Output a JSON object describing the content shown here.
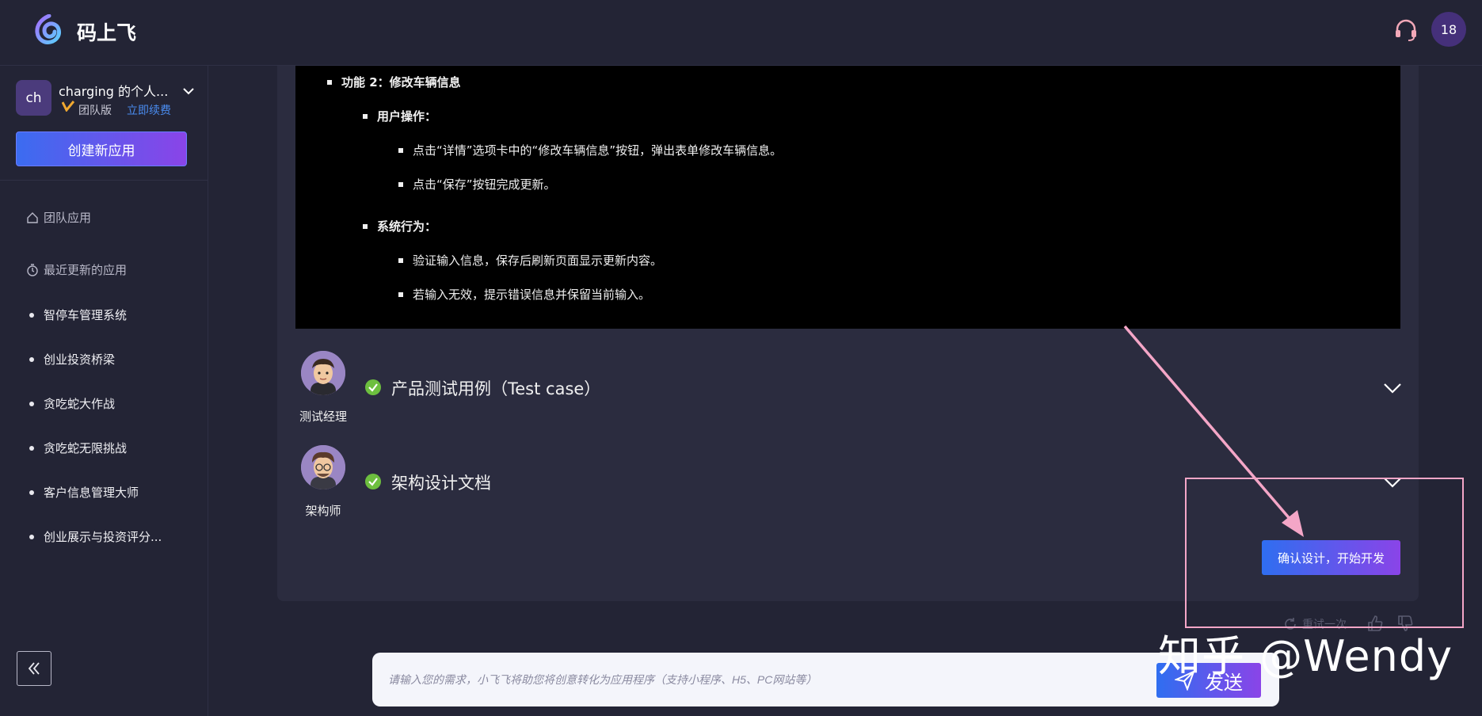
{
  "header": {
    "brand": "码上飞",
    "user_badge": "18"
  },
  "sidebar": {
    "team_avatar": "ch",
    "team_name": "charging 的个人...",
    "edition": "团队版",
    "renew_label": "立即续费",
    "create_button": "创建新应用",
    "sections": {
      "team_apps": "团队应用",
      "recent_apps": "最近更新的应用"
    },
    "apps": [
      "智停车管理系统",
      "创业投资桥梁",
      "贪吃蛇大作战",
      "贪吃蛇无限挑战",
      "客户信息管理大师",
      "创业展示与投资评分..."
    ]
  },
  "doc": {
    "lines": [
      "功能 2：修改车辆信息",
      "用户操作：",
      "点击“详情”选项卡中的“修改车辆信息”按钮，弹出表单修改车辆信息。",
      "点击“保存”按钮完成更新。",
      "系统行为：",
      "验证输入信息，保存后刷新页面显示更新内容。",
      "若输入无效，提示错误信息并保留当前输入。"
    ]
  },
  "agents": [
    {
      "role": "测试经理",
      "title": "产品测试用例（Test case）"
    },
    {
      "role": "架构师",
      "title": "架构设计文档"
    }
  ],
  "actions": {
    "confirm_button": "确认设计，开始开发",
    "retry_label": "重试一次"
  },
  "input": {
    "placeholder": "请输入您的需求，小飞飞将助您将创意转化为应用程序（支持小程序、H5、PC网站等）",
    "send_label": "发送"
  },
  "watermark": "知乎 @Wendy",
  "colors": {
    "background": "#232435",
    "accent_start": "#2f6ef0",
    "accent_end": "#8a44e8",
    "success": "#6dbf3f",
    "annotation": "#f4a6c7"
  }
}
